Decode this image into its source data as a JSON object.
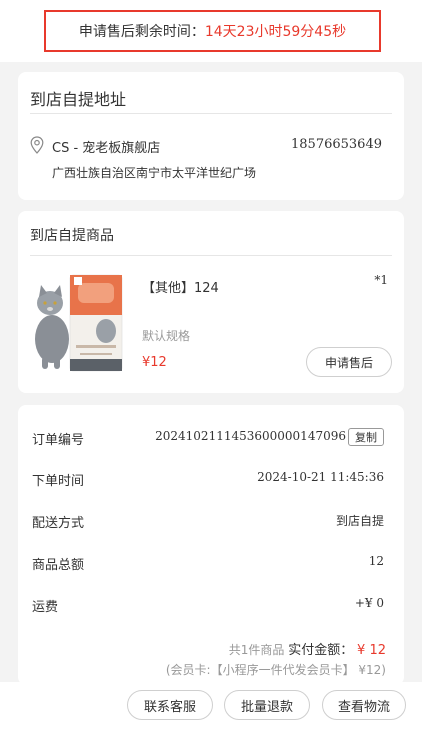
{
  "timer": {
    "label": "申请售后剩余时间：",
    "value": "14天23小时59分45秒"
  },
  "pickup": {
    "title": "到店自提地址",
    "store_name": "CS - 宠老板旗舰店",
    "phone": "18576653649",
    "address": "广西壮族自治区南宁市太平洋世纪广场",
    "icon": "location-pin-icon"
  },
  "goods": {
    "title": "到店自提商品",
    "name": "【其他】124",
    "qty": "*1",
    "spec": "默认规格",
    "price": "¥12",
    "aftersale_label": "申请售后"
  },
  "order": {
    "number_label": "订单编号",
    "number": "20241021114536000001470 96",
    "copy_label": "复制",
    "time_label": "下单时间",
    "time": "2024-10-21 11:45:36",
    "delivery_label": "配送方式",
    "delivery": "到店自提",
    "total_label": "商品总额",
    "total": "12",
    "shipping_label": "运费",
    "shipping": "+¥ 0",
    "summary_count": "共1件商品",
    "paid_label": "实付金额：",
    "paid": "¥ 12",
    "member_note": "(会员卡:【小程序一件代发会员卡】 ¥12)"
  },
  "actions": {
    "service": "联系客服",
    "refund": "批量退款",
    "logistics": "查看物流"
  },
  "colors": {
    "accent": "#e8392c",
    "muted": "#999999"
  }
}
